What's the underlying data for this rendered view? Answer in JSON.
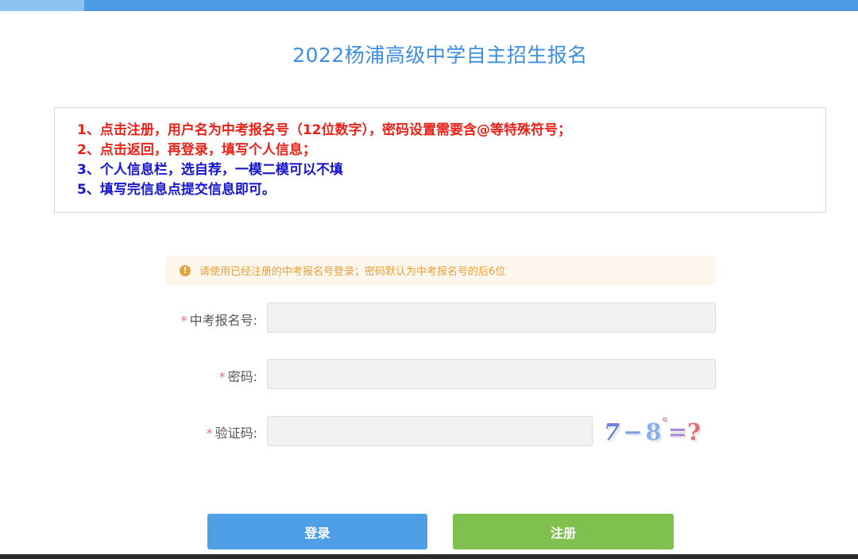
{
  "page": {
    "title": "2022杨浦高级中学自主招生报名"
  },
  "notice": {
    "lines": [
      {
        "text": "1、点击注册，用户名为中考报名号（12位数字），密码设置需要含@等特殊符号；",
        "color": "#e8231a"
      },
      {
        "text": "2、点击返回，再登录，填写个人信息；",
        "color": "#e8231a"
      },
      {
        "text": "3、个人信息栏，选自荐，一模二模可以不填",
        "color": "#1515cc"
      },
      {
        "text": "5、填写完信息点提交信息即可。",
        "color": "#1515cc"
      }
    ]
  },
  "alert": {
    "icon": "warning-circle-icon",
    "text": "请使用已经注册的中考报名号登录；密码默认为中考报名号的后6位"
  },
  "form": {
    "required_mark": "*",
    "exam_number": {
      "label": "中考报名号:",
      "value": "",
      "placeholder": ""
    },
    "password": {
      "label": "密码:",
      "value": "",
      "placeholder": ""
    },
    "captcha": {
      "label": "验证码:",
      "value": "",
      "placeholder": ""
    }
  },
  "captcha_image": {
    "chars": [
      "7",
      "−",
      "8",
      "°",
      "=",
      "?"
    ],
    "colors": [
      "#6b7fd8",
      "#7c9ee0",
      "#8ab0e8",
      "#d97a9a",
      "#a78ad8",
      "#e56a6a"
    ]
  },
  "buttons": {
    "login": "登录",
    "register": "注册"
  },
  "colors": {
    "accent": "#4e9be3",
    "title": "#3d8ee0",
    "register": "#7fc04e",
    "warning": "#e6a23c"
  }
}
